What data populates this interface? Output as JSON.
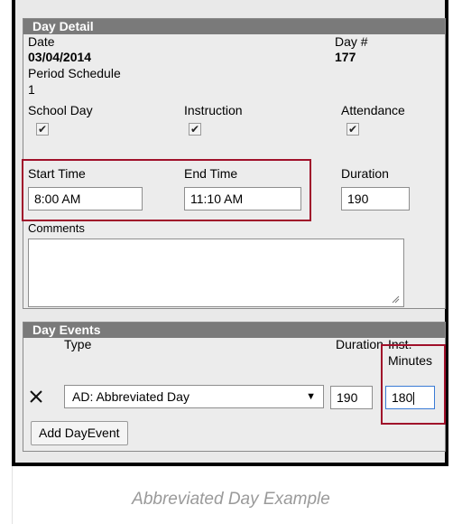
{
  "day_detail": {
    "title": "Day Detail",
    "date_label": "Date",
    "date_value": "03/04/2014",
    "day_num_label": "Day #",
    "day_num_value": "177",
    "period_schedule_label": "Period Schedule",
    "period_schedule_value": "1",
    "school_day_label": "School Day",
    "school_day_checked": true,
    "instruction_label": "Instruction",
    "instruction_checked": true,
    "attendance_label": "Attendance",
    "attendance_checked": true,
    "start_time_label": "Start Time",
    "start_time_value": "8:00 AM",
    "end_time_label": "End Time",
    "end_time_value": "11:10 AM",
    "duration_label": "Duration",
    "duration_value": "190",
    "comments_label": "Comments",
    "comments_value": ""
  },
  "day_events": {
    "title": "Day Events",
    "type_label": "Type",
    "duration_label": "Duration",
    "inst_label_line1": "Inst.",
    "inst_label_line2": "Minutes",
    "event_type_value": "AD: Abbreviated Day",
    "event_duration_value": "190",
    "event_inst_minutes_value": "180",
    "add_button_label": "Add DayEvent"
  },
  "caption": "Abbreviated Day Example",
  "colors": {
    "highlight": "#a0102a",
    "header_bg": "#7a7a7a",
    "panel_bg": "#ececec"
  }
}
